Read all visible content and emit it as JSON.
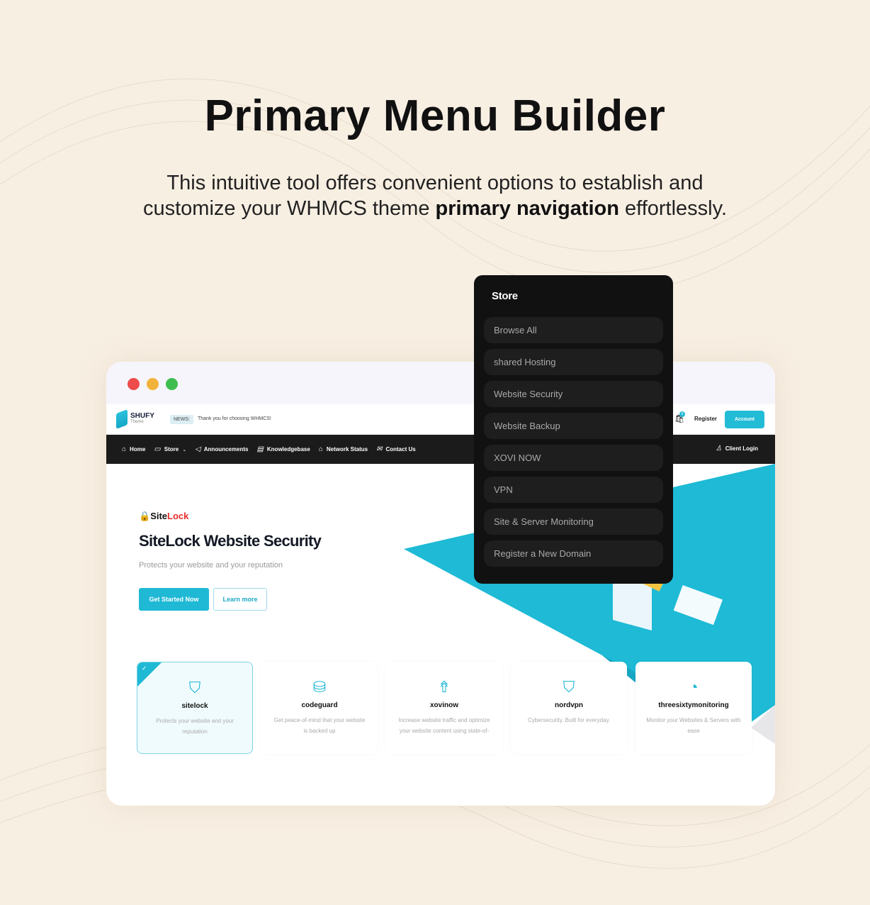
{
  "heading": "Primary Menu Builder",
  "subtitle": {
    "line1": "This intuitive tool offers convenient options to establish and",
    "line2_pre": "customize your WHMCS theme ",
    "line2_bold": "primary navigation",
    "line2_post": " effortlessly."
  },
  "colors": {
    "accent": "#1fb9d5",
    "nav_bg": "#1b1b1b",
    "dropdown_bg": "#111111",
    "page_bg": "#f8efe3"
  },
  "window": {
    "header": {
      "logo": "SHUFY",
      "logo_sub": "Theme",
      "news_label": "NEWS:",
      "news_text": "Thank you for choosing WHMCS!",
      "cart_count": "0",
      "register": "Register",
      "account": "Account"
    },
    "nav": {
      "items": [
        {
          "icon": "home-icon",
          "label": "Home"
        },
        {
          "icon": "store-icon",
          "label": "Store"
        },
        {
          "icon": "megaphone-icon",
          "label": "Announcements"
        },
        {
          "icon": "book-icon",
          "label": "Knowledgebase"
        },
        {
          "icon": "home-icon",
          "label": "Network Status"
        },
        {
          "icon": "mail-icon",
          "label": "Contact Us"
        }
      ],
      "client_login": "Client Login"
    },
    "hero": {
      "brand_a": "Site",
      "brand_b": "Lock",
      "title": "SiteLock Website Security",
      "desc": "Protects your website and your reputation",
      "primary_btn": "Get Started Now",
      "secondary_btn": "Learn more"
    },
    "cards": [
      {
        "icon": "shield-lock-icon",
        "name": "sitelock",
        "desc": "Protects your website and your reputation",
        "selected": true
      },
      {
        "icon": "database-upload-icon",
        "name": "codeguard",
        "desc": "Get peace-of-mind that your website is backed up"
      },
      {
        "icon": "rocket-icon",
        "name": "xovinow",
        "desc": "Increase website traffic and optimize your website content using state-of-"
      },
      {
        "icon": "shield-wifi-icon",
        "name": "nordvpn",
        "desc": "Cybersecurity. Built for everyday."
      },
      {
        "icon": "monitor-chart-icon",
        "name": "threesixtymonitoring",
        "desc": "Monitor your Websites & Servers with ease"
      }
    ]
  },
  "dropdown": {
    "title": "Store",
    "items": [
      "Browse All",
      "shared Hosting",
      "Website Security",
      "Website Backup",
      "XOVI NOW",
      "VPN",
      "Site & Server Monitoring",
      "Register a New Domain"
    ]
  }
}
